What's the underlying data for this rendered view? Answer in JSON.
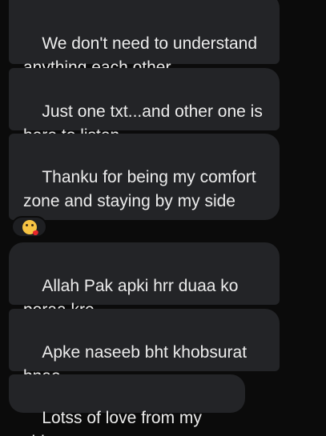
{
  "messages": [
    {
      "id": "m1",
      "text": "We don't need to understand anything each other...."
    },
    {
      "id": "m2",
      "text": "Just one txt...and other one is here to listen"
    },
    {
      "id": "m3",
      "text": "Thanku for being my comfort zone and staying by my side",
      "emojis": [
        "❤️",
        "😘"
      ]
    },
    {
      "id": "m4",
      "text": "Allah Pak apki hrr duaa ko poraa kre"
    },
    {
      "id": "m5",
      "text": "Apke naseeb bht khobsurat bnae"
    },
    {
      "id": "m6",
      "text": "Lotss of love from my side"
    }
  ],
  "reaction": {
    "emoji": "😘",
    "icon_name": "kissing-face-icon"
  },
  "colors": {
    "background": "#0b0b0b",
    "bubble": "#232427",
    "text": "#ececec",
    "heart": "#e5252a",
    "emoji_face": "#f7c443"
  }
}
